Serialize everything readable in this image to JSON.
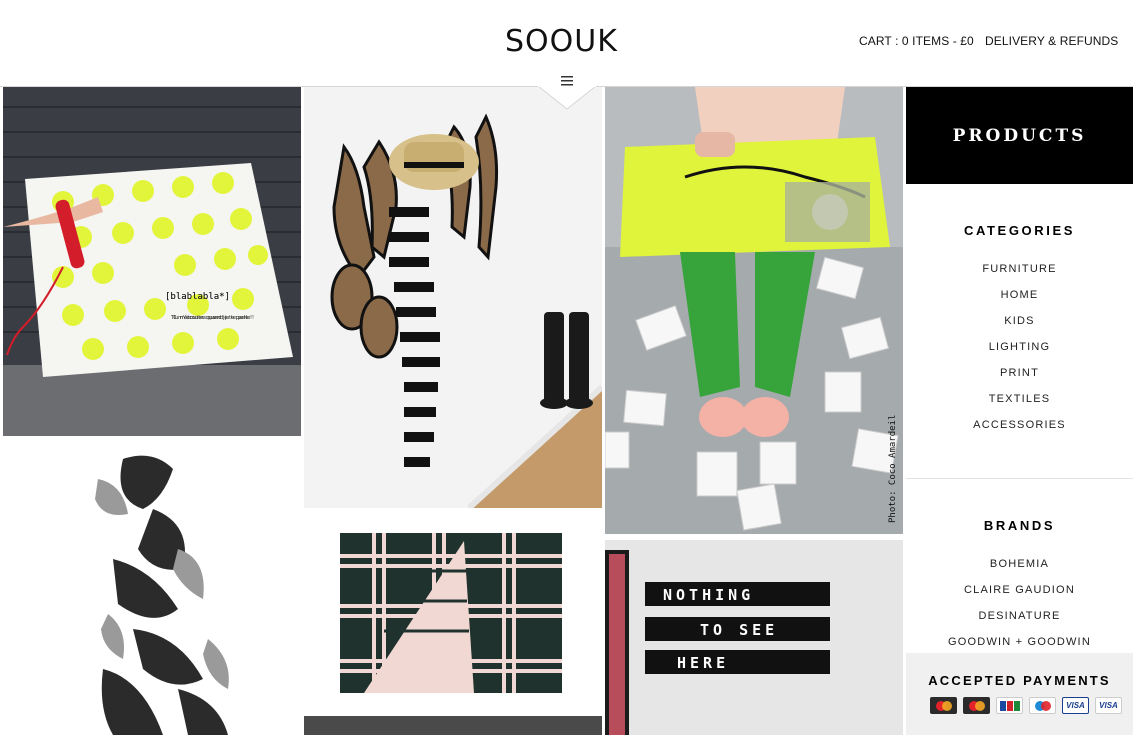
{
  "header": {
    "logo": "SOOUK",
    "cart_label": "CART : 0 ITEMS - £0",
    "delivery_label": "DELIVERY & REFUNDS",
    "menu_icon": "hamburger-icon"
  },
  "tiles": {
    "notebook_caption": "[blablabla*]",
    "notebook_subtext": "Tu m'écoutes quand je te parle !",
    "photo_credit": "Photo: Coco Amardeil",
    "sign_lines": [
      "NOTHING",
      "TO SEE",
      "HERE"
    ]
  },
  "sidebar": {
    "products_label": "PRODUCTS",
    "categories_title": "CATEGORIES",
    "categories": [
      "FURNITURE",
      "HOME",
      "KIDS",
      "LIGHTING",
      "PRINT",
      "TEXTILES",
      "ACCESSORIES"
    ],
    "brands_title": "BRANDS",
    "brands": [
      "BOHEMIA",
      "CLAIRE GAUDION",
      "DESINATURE",
      "GOODWIN + GOODWIN"
    ],
    "payments_title": "ACCEPTED PAYMENTS",
    "payment_icons": [
      "mastercard-icon",
      "mastercard-icon",
      "jcb-icon",
      "maestro-icon",
      "visa-icon",
      "visa-icon"
    ],
    "payment_labels": [
      "MC",
      "MC",
      "JCB",
      "MA",
      "VISA",
      "VISA"
    ]
  },
  "colors": {
    "accent_neon": "#e2f53a",
    "products_bg": "#000000",
    "payments_bg": "#f0f0f0"
  }
}
